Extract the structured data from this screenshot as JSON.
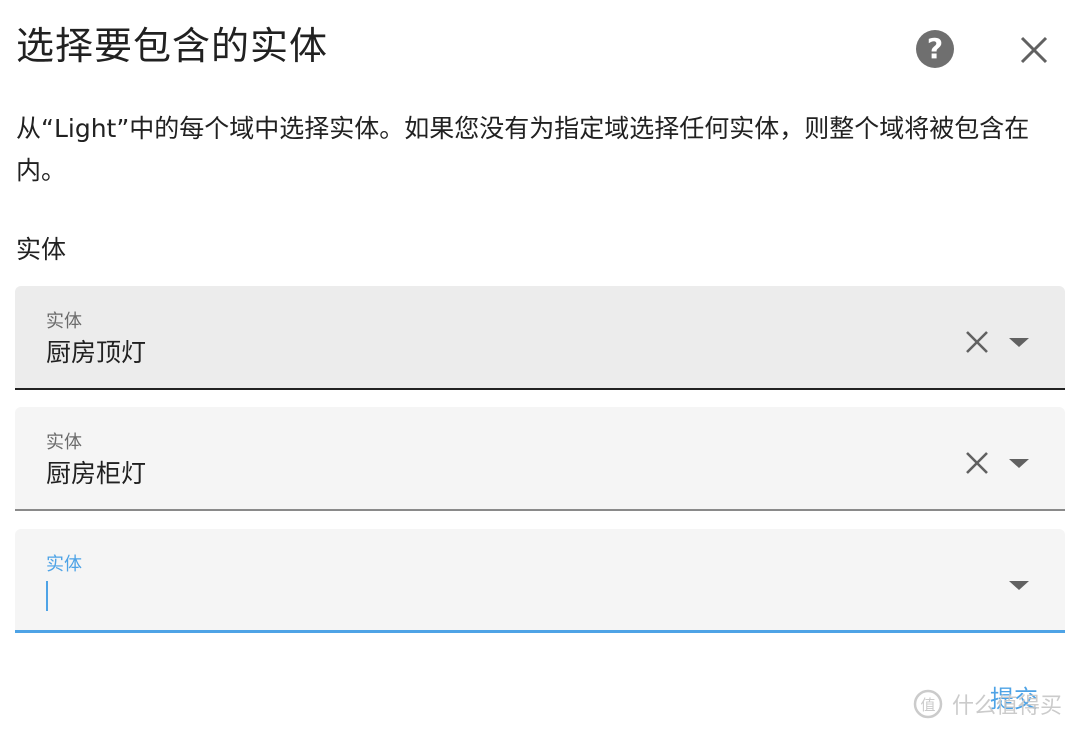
{
  "dialog": {
    "title": "选择要包含的实体",
    "description": "从“Light”中的每个域中选择实体。如果您没有为指定域选择任何实体，则整个域将被包含在内。",
    "section_label": "实体",
    "help_icon": "help-circle-icon",
    "close_icon": "close-icon"
  },
  "fields": [
    {
      "label": "实体",
      "value": "厨房顶灯"
    },
    {
      "label": "实体",
      "value": "厨房柜灯"
    },
    {
      "label": "实体",
      "value": ""
    }
  ],
  "actions": {
    "submit_label": "提交"
  },
  "watermark": {
    "text": "什么值得买"
  },
  "colors": {
    "accent": "#4ea3e6",
    "field_bg": "#f5f5f5",
    "text": "#212121"
  }
}
